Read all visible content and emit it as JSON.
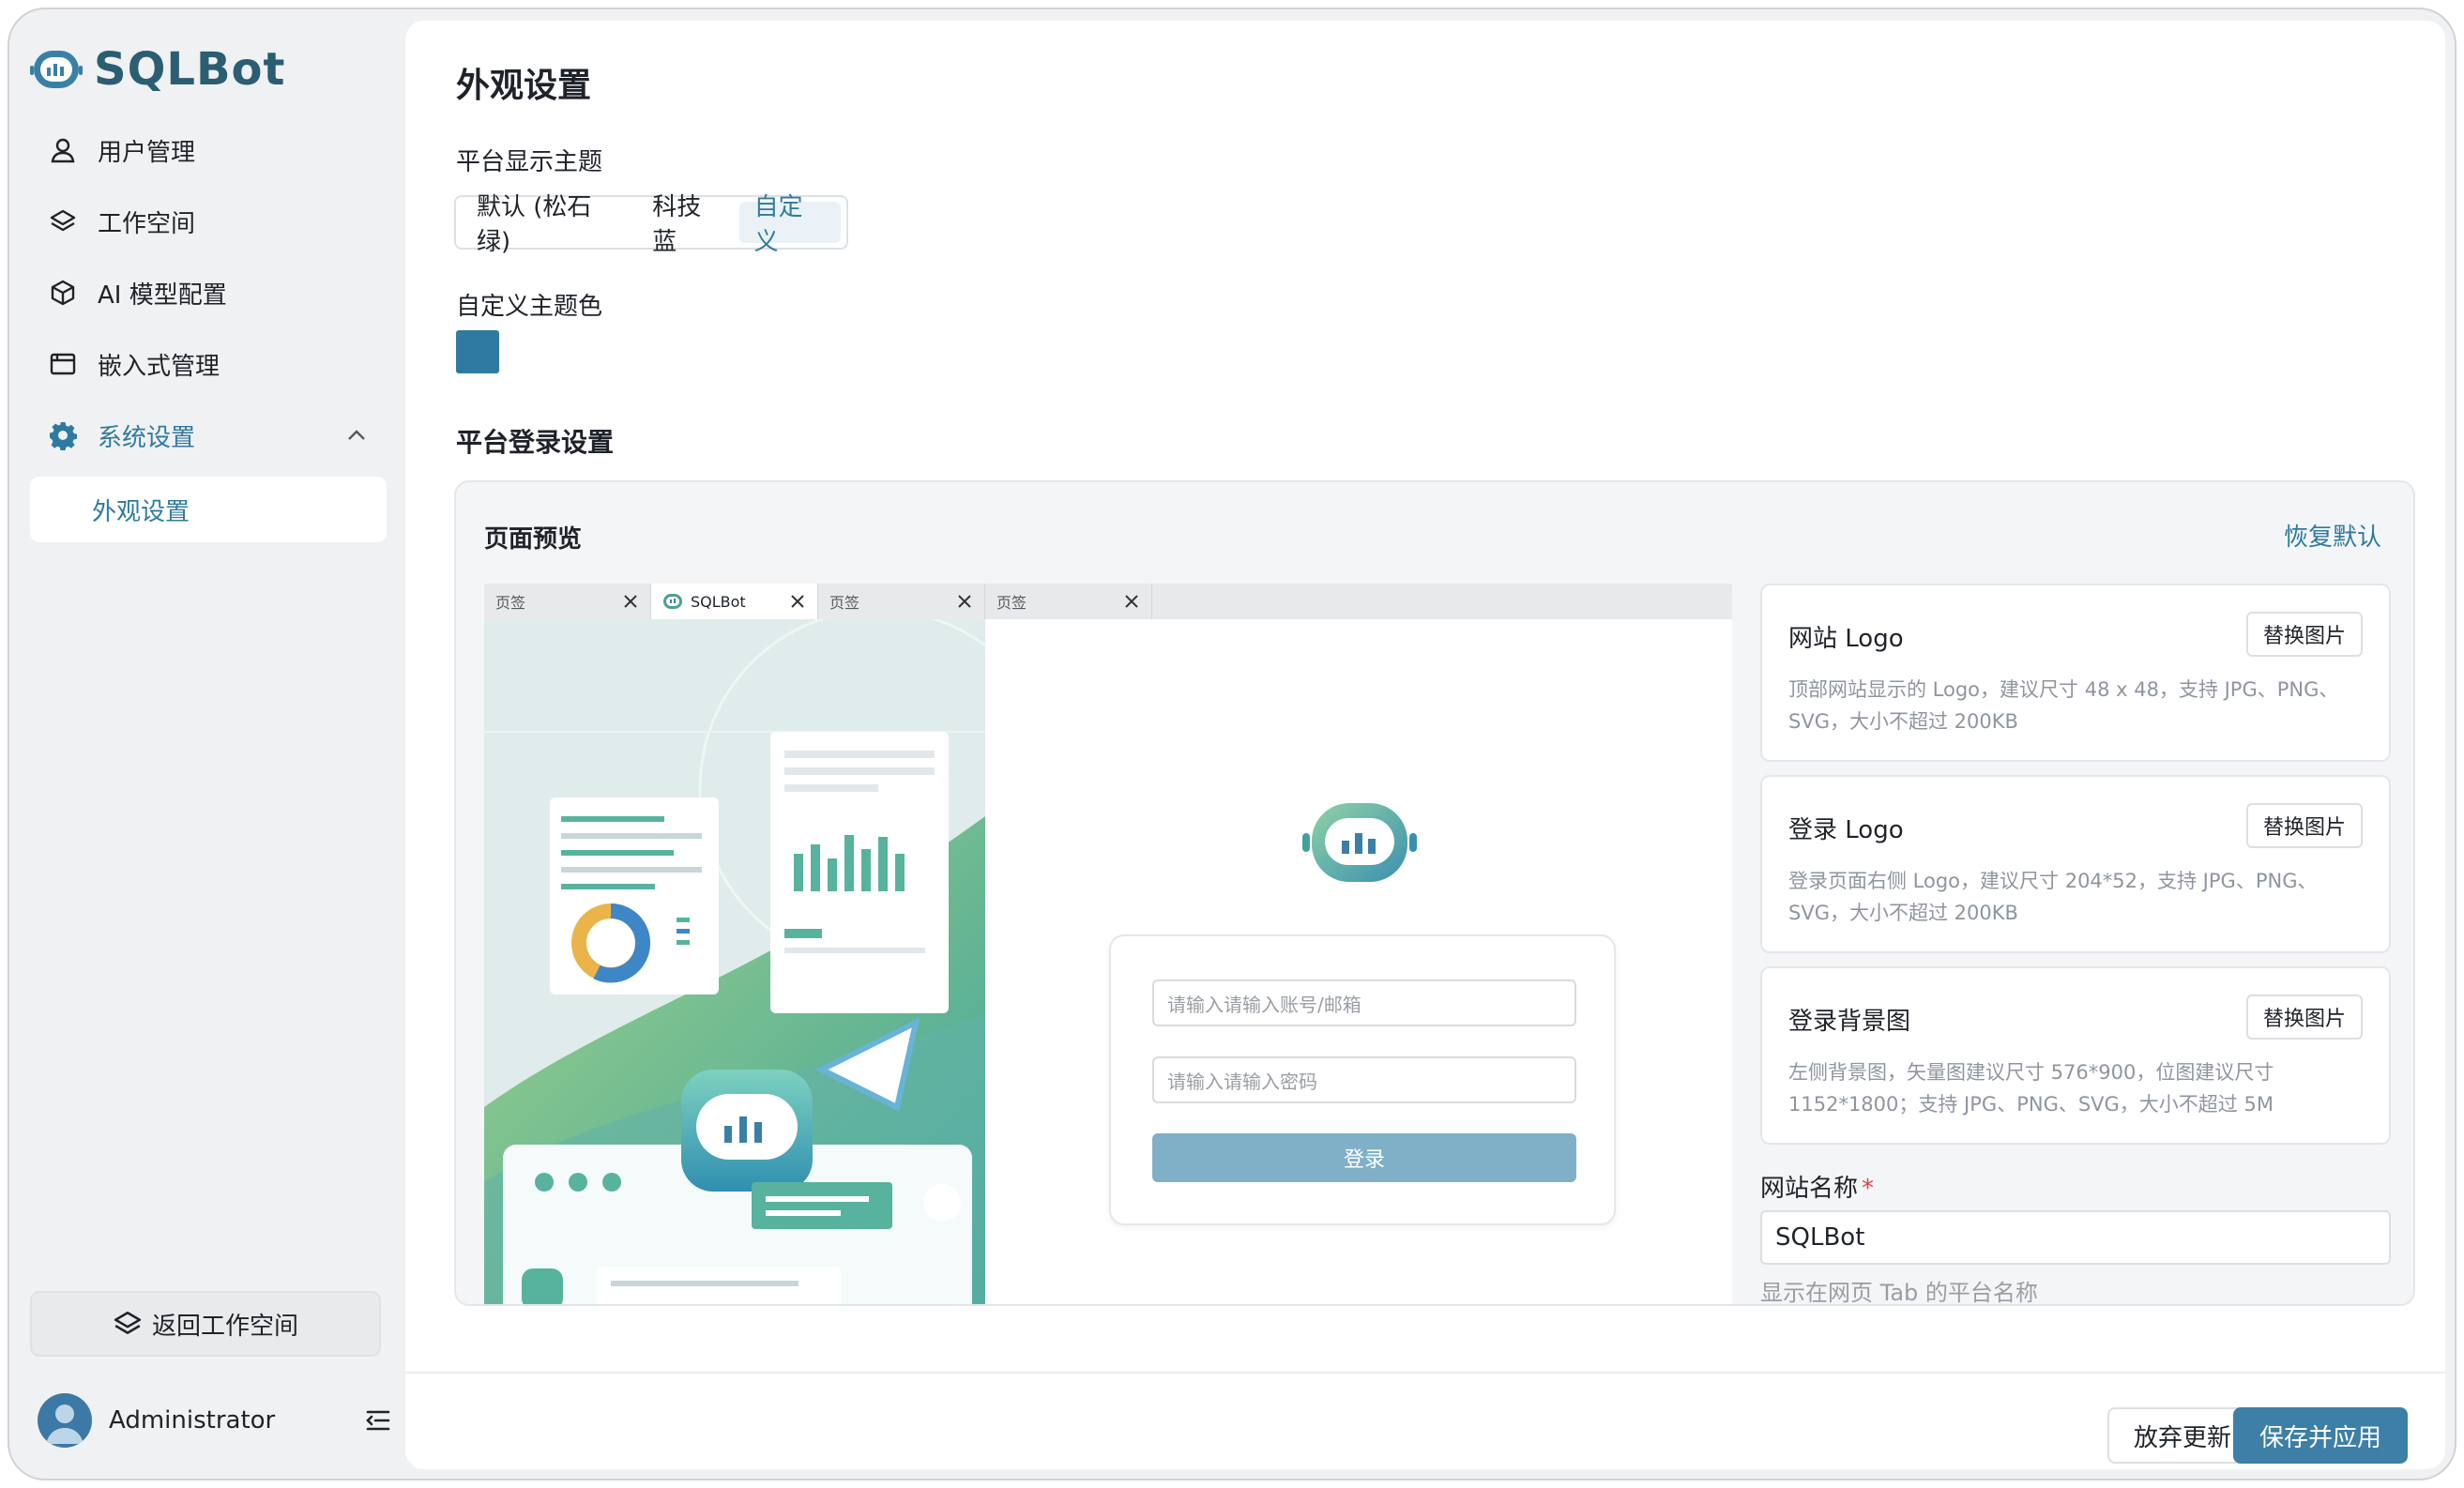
{
  "brand": {
    "name": "SQLBot"
  },
  "sidebar": {
    "items": [
      {
        "label": "用户管理",
        "icon": "user-icon"
      },
      {
        "label": "工作空间",
        "icon": "layers-icon"
      },
      {
        "label": "AI 模型配置",
        "icon": "cube-icon"
      },
      {
        "label": "嵌入式管理",
        "icon": "window-icon"
      },
      {
        "label": "系统设置",
        "icon": "gear-icon"
      }
    ],
    "sub_items": [
      {
        "label": "外观设置"
      }
    ],
    "back_button": "返回工作空间",
    "user_name": "Administrator"
  },
  "page": {
    "title": "外观设置",
    "theme_label": "平台显示主题",
    "theme_options": [
      "默认 (松石绿)",
      "科技蓝",
      "自定义"
    ],
    "selected_theme": "自定义",
    "custom_color_label": "自定义主题色",
    "custom_color": "#2f7aa0",
    "login_section_title": "平台登录设置"
  },
  "preview": {
    "title": "页面预览",
    "reset": "恢复默认",
    "tabs": [
      "页签",
      "SQLBot",
      "页签",
      "页签"
    ],
    "username_placeholder": "请输入请输入账号/邮箱",
    "password_placeholder": "请输入请输入密码",
    "login_button": "登录"
  },
  "uploads": [
    {
      "title": "网站 Logo",
      "button": "替换图片",
      "desc": "顶部网站显示的 Logo，建议尺寸 48 x 48，支持 JPG、PNG、SVG，大小不超过 200KB"
    },
    {
      "title": "登录 Logo",
      "button": "替换图片",
      "desc": "登录页面右侧 Logo，建议尺寸 204*52，支持 JPG、PNG、SVG，大小不超过 200KB"
    },
    {
      "title": "登录背景图",
      "button": "替换图片",
      "desc": "左侧背景图，矢量图建议尺寸 576*900，位图建议尺寸 1152*1800；支持 JPG、PNG、SVG，大小不超过 5M"
    }
  ],
  "site_name": {
    "label": "网站名称",
    "required_mark": "*",
    "value": "SQLBot",
    "help": "显示在网页 Tab 的平台名称"
  },
  "footer": {
    "discard": "放弃更新",
    "save": "保存并应用"
  },
  "colors": {
    "accent": "#2f7aa0",
    "save_button": "#3d7fa6",
    "brand_text": "#2b5d73"
  }
}
